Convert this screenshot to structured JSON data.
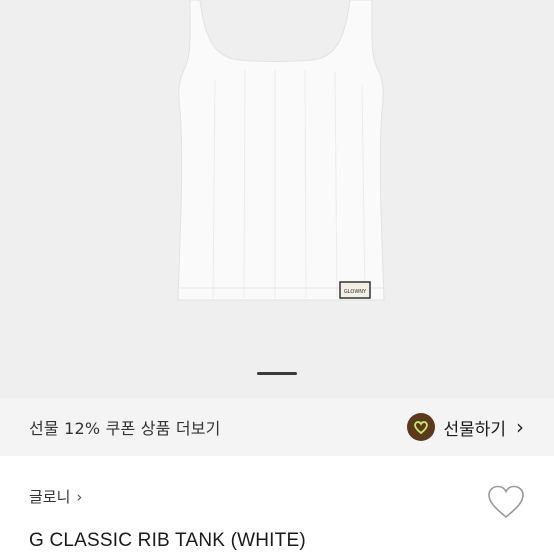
{
  "product": {
    "image_alt": "white rib tank top",
    "tag_text": "GLOWNY"
  },
  "promo": {
    "text": "선물 12% 쿠폰 상품 더보기",
    "gift_label": "선물하기",
    "gift_chevron": "›"
  },
  "brand": {
    "name": "글로니",
    "chevron": "›"
  },
  "title": "G CLASSIC RIB TANK (WHITE)",
  "icons": {
    "gift": "gift-heart-icon",
    "wishlist": "heart-outline-icon"
  },
  "colors": {
    "hero_bg": "#efefef",
    "promo_bg": "#f4f4f4",
    "gift_icon_bg": "#5a3a1c"
  }
}
